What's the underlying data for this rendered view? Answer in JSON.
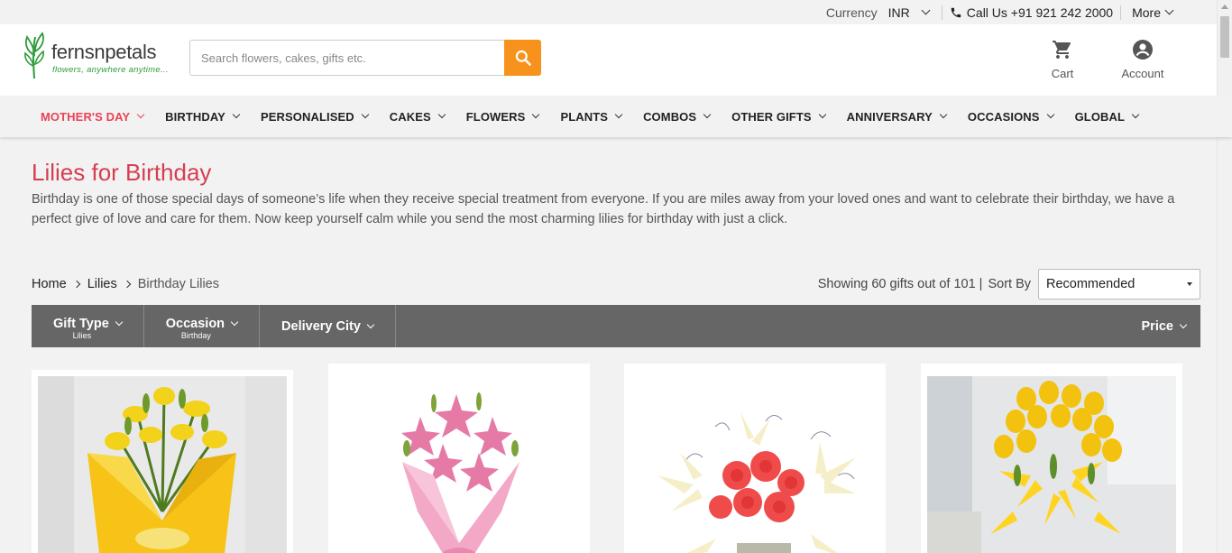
{
  "topbar": {
    "currency_label": "Currency",
    "currency_value": "INR",
    "call_label": "Call Us +91 921 242 2000",
    "more_label": "More"
  },
  "header": {
    "logo_text": "fernsnpetals",
    "logo_tagline": "flowers, anywhere anytime...",
    "search_placeholder": "Search flowers, cakes, gifts etc.",
    "cart_label": "Cart",
    "account_label": "Account"
  },
  "nav": {
    "items": [
      {
        "label": "MOTHER'S DAY"
      },
      {
        "label": "BIRTHDAY"
      },
      {
        "label": "PERSONALISED"
      },
      {
        "label": "CAKES"
      },
      {
        "label": "FLOWERS"
      },
      {
        "label": "PLANTS"
      },
      {
        "label": "COMBOS"
      },
      {
        "label": "OTHER GIFTS"
      },
      {
        "label": "ANNIVERSARY"
      },
      {
        "label": "OCCASIONS"
      },
      {
        "label": "GLOBAL"
      }
    ]
  },
  "page": {
    "title": "Lilies for Birthday",
    "description": "Birthday is one of those special days of someone’s life when they receive special treatment from everyone. If you are miles away from your loved ones and want to celebrate their birthday, we have a perfect give of love and care for them. Now keep yourself calm while you send the most charming lilies for birthday with just a click."
  },
  "breadcrumb": {
    "items": [
      "Home",
      "Lilies",
      "Birthday Lilies"
    ]
  },
  "sort": {
    "showing_text": "Showing 60 gifts out of 101 |",
    "sort_by_label": "Sort By",
    "selected": "Recommended"
  },
  "filters": {
    "gift_type": {
      "label": "Gift Type",
      "value": "Lilies"
    },
    "occasion": {
      "label": "Occasion",
      "value": "Birthday"
    },
    "delivery_city": {
      "label": "Delivery City"
    },
    "price": {
      "label": "Price"
    }
  },
  "colors": {
    "accent_red": "#e94256",
    "title_red": "#d43f52",
    "search_orange": "#f7931d",
    "filter_bar": "#666666",
    "logo_green": "#2e9b3a"
  }
}
